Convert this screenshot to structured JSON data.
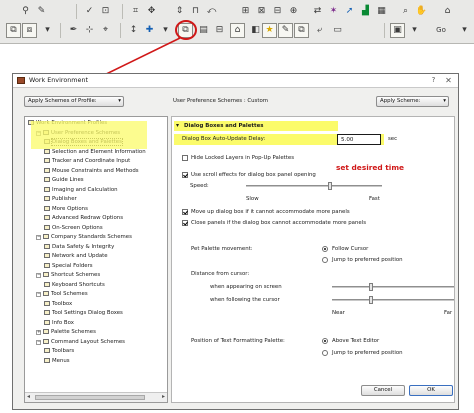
{
  "dialog": {
    "title": "Work Environment",
    "apply_profile_label": "Apply Schemes of Profile:",
    "breadcrumb": "User Preference Schemes : Custom",
    "apply_scheme_label": "Apply Scheme:",
    "section_title": "Dialog Boxes and Palettes",
    "cancel_label": "Cancel",
    "ok_label": "OK"
  },
  "tree": {
    "items": [
      {
        "label": "Work Environment Profiles",
        "indent": 0,
        "expand": ""
      },
      {
        "label": "User Preference Schemes",
        "indent": 1,
        "expand": "−"
      },
      {
        "label": "Dialog Boxes and Palettes",
        "indent": 2,
        "expand": "",
        "selected": true
      },
      {
        "label": "Selection and Element Information",
        "indent": 2,
        "expand": ""
      },
      {
        "label": "Tracker and Coordinate Input",
        "indent": 2,
        "expand": ""
      },
      {
        "label": "Mouse Constraints and Methods",
        "indent": 2,
        "expand": ""
      },
      {
        "label": "Guide Lines",
        "indent": 2,
        "expand": ""
      },
      {
        "label": "Imaging and Calculation",
        "indent": 2,
        "expand": ""
      },
      {
        "label": "Publisher",
        "indent": 2,
        "expand": ""
      },
      {
        "label": "More Options",
        "indent": 2,
        "expand": ""
      },
      {
        "label": "Advanced Redraw Options",
        "indent": 2,
        "expand": ""
      },
      {
        "label": "On-Screen Options",
        "indent": 2,
        "expand": ""
      },
      {
        "label": "Company Standards Schemes",
        "indent": 1,
        "expand": "−"
      },
      {
        "label": "Data Safety & Integrity",
        "indent": 2,
        "expand": ""
      },
      {
        "label": "Network and Update",
        "indent": 2,
        "expand": ""
      },
      {
        "label": "Special Folders",
        "indent": 2,
        "expand": ""
      },
      {
        "label": "Shortcut Schemes",
        "indent": 1,
        "expand": "−"
      },
      {
        "label": "Keyboard Shortcuts",
        "indent": 2,
        "expand": ""
      },
      {
        "label": "Tool Schemes",
        "indent": 1,
        "expand": "−"
      },
      {
        "label": "Toolbox",
        "indent": 2,
        "expand": ""
      },
      {
        "label": "Tool Settings Dialog Boxes",
        "indent": 2,
        "expand": ""
      },
      {
        "label": "Info Box",
        "indent": 2,
        "expand": ""
      },
      {
        "label": "Palette Schemes",
        "indent": 1,
        "expand": "+"
      },
      {
        "label": "Command Layout Schemes",
        "indent": 1,
        "expand": "−"
      },
      {
        "label": "Toolbars",
        "indent": 2,
        "expand": ""
      },
      {
        "label": "Menus",
        "indent": 2,
        "expand": ""
      }
    ]
  },
  "settings": {
    "auto_update_label": "Dialog Box Auto-Update Delay:",
    "auto_update_value": "5.00",
    "auto_update_unit": "sec",
    "hide_locked_label": "Hide Locked Layers in Pop-Up Palettes",
    "hide_locked_checked": false,
    "scroll_effects_label": "Use scroll effects for dialog box panel opening",
    "scroll_effects_checked": true,
    "speed_label": "Speed:",
    "speed_slow": "Slow",
    "speed_fast": "Fast",
    "speed_value": 0.62,
    "move_up_label": "Move up dialog box if it cannot accommodate more panels",
    "move_up_checked": true,
    "close_panels_label": "Close panels if the dialog box cannot accommodate more panels",
    "close_panels_checked": true,
    "pet_palette_label": "Pet Palette movement:",
    "pet_follow_label": "Follow Cursor",
    "pet_jump_label": "Jump to preferred position",
    "pet_selected": "follow",
    "distance_label": "Distance from cursor:",
    "appearing_label": "when appearing on screen",
    "following_label": "when following the cursor",
    "distance_near": "Near",
    "distance_far": "Far",
    "appearing_value": 0.32,
    "following_value": 0.32,
    "text_palette_label": "Position of Text Formatting Palette:",
    "text_above_label": "Above Text Editor",
    "text_jump_label": "Jump to preferred position",
    "text_selected": "above"
  },
  "annotation": {
    "callout_text": "set desired time",
    "color": "#d01818",
    "highlight_color": "#fbfb6a"
  },
  "toolbar": {
    "go_label": "Go",
    "icons": [
      "magic-wand-icon",
      "pin-icon",
      "link-icon",
      "eyedropper-icon",
      "arrow-icon",
      "camera-icon",
      "work-environment-icon",
      "star-icon",
      "cursor-icon",
      "navigator-icon"
    ]
  }
}
